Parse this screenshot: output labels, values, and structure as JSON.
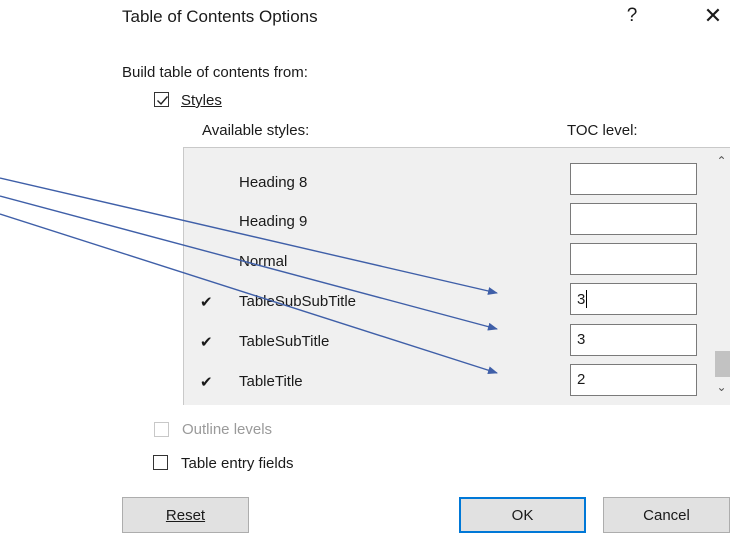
{
  "dialog": {
    "title": "Table of Contents Options",
    "help_label": "?",
    "close_label": "✕"
  },
  "build_from_label": "Build table of contents from:",
  "styles_option": {
    "label": "Styles",
    "checked": true
  },
  "columns": {
    "available": "Available styles:",
    "toc_level": "TOC level:"
  },
  "style_rows": [
    {
      "check": "",
      "name": "Heading 8",
      "level": ""
    },
    {
      "check": "",
      "name": "Heading 9",
      "level": ""
    },
    {
      "check": "",
      "name": "Normal",
      "level": ""
    },
    {
      "check": "✔",
      "name": "TableSubSubTitle",
      "level": "3"
    },
    {
      "check": "✔",
      "name": "TableSubTitle",
      "level": "3"
    },
    {
      "check": "✔",
      "name": "TableTitle",
      "level": "2"
    }
  ],
  "outline_levels": {
    "label": "Outline levels",
    "checked": false,
    "enabled": false
  },
  "table_entry_fields": {
    "label": "Table entry fields",
    "checked": false
  },
  "buttons": {
    "reset": "Reset",
    "ok": "OK",
    "cancel": "Cancel"
  },
  "colors": {
    "accent": "#0078d7",
    "arrow": "#3f5fa8"
  },
  "icons": {
    "checkmark": "check-icon",
    "help": "help-icon",
    "close": "close-icon",
    "scroll_up": "chevron-up-icon",
    "scroll_down": "chevron-down-icon"
  }
}
